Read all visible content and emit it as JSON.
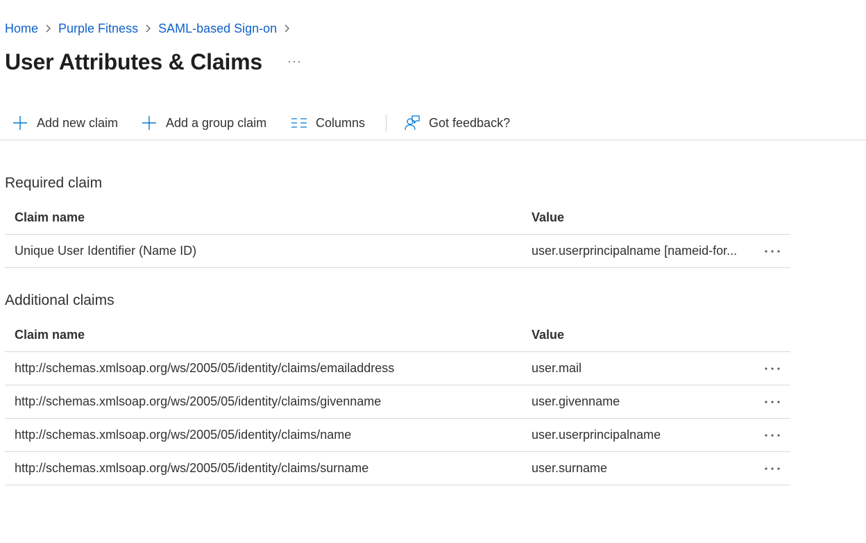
{
  "breadcrumb": [
    {
      "label": "Home"
    },
    {
      "label": "Purple Fitness"
    },
    {
      "label": "SAML-based Sign-on"
    }
  ],
  "title": "User Attributes & Claims",
  "toolbar": {
    "add_claim_label": "Add new claim",
    "add_group_claim_label": "Add a group claim",
    "columns_label": "Columns",
    "feedback_label": "Got feedback?"
  },
  "required": {
    "heading": "Required claim",
    "columns": {
      "name": "Claim name",
      "value": "Value"
    },
    "rows": [
      {
        "name": "Unique User Identifier (Name ID)",
        "value": "user.userprincipalname [nameid-for..."
      }
    ]
  },
  "additional": {
    "heading": "Additional claims",
    "columns": {
      "name": "Claim name",
      "value": "Value"
    },
    "rows": [
      {
        "name": "http://schemas.xmlsoap.org/ws/2005/05/identity/claims/emailaddress",
        "value": "user.mail"
      },
      {
        "name": "http://schemas.xmlsoap.org/ws/2005/05/identity/claims/givenname",
        "value": "user.givenname"
      },
      {
        "name": "http://schemas.xmlsoap.org/ws/2005/05/identity/claims/name",
        "value": "user.userprincipalname"
      },
      {
        "name": "http://schemas.xmlsoap.org/ws/2005/05/identity/claims/surname",
        "value": "user.surname"
      }
    ]
  },
  "colors": {
    "link": "#0f62c8",
    "accent": "#0078d4",
    "text": "#323130",
    "divider": "#d9d8d6"
  },
  "icons": {
    "add": "plus-icon",
    "add_group": "plus-icon",
    "columns": "columns-icon",
    "feedback": "feedback-icon",
    "more": "more-icon",
    "breadcrumb_separator": "chevron-right-icon"
  }
}
